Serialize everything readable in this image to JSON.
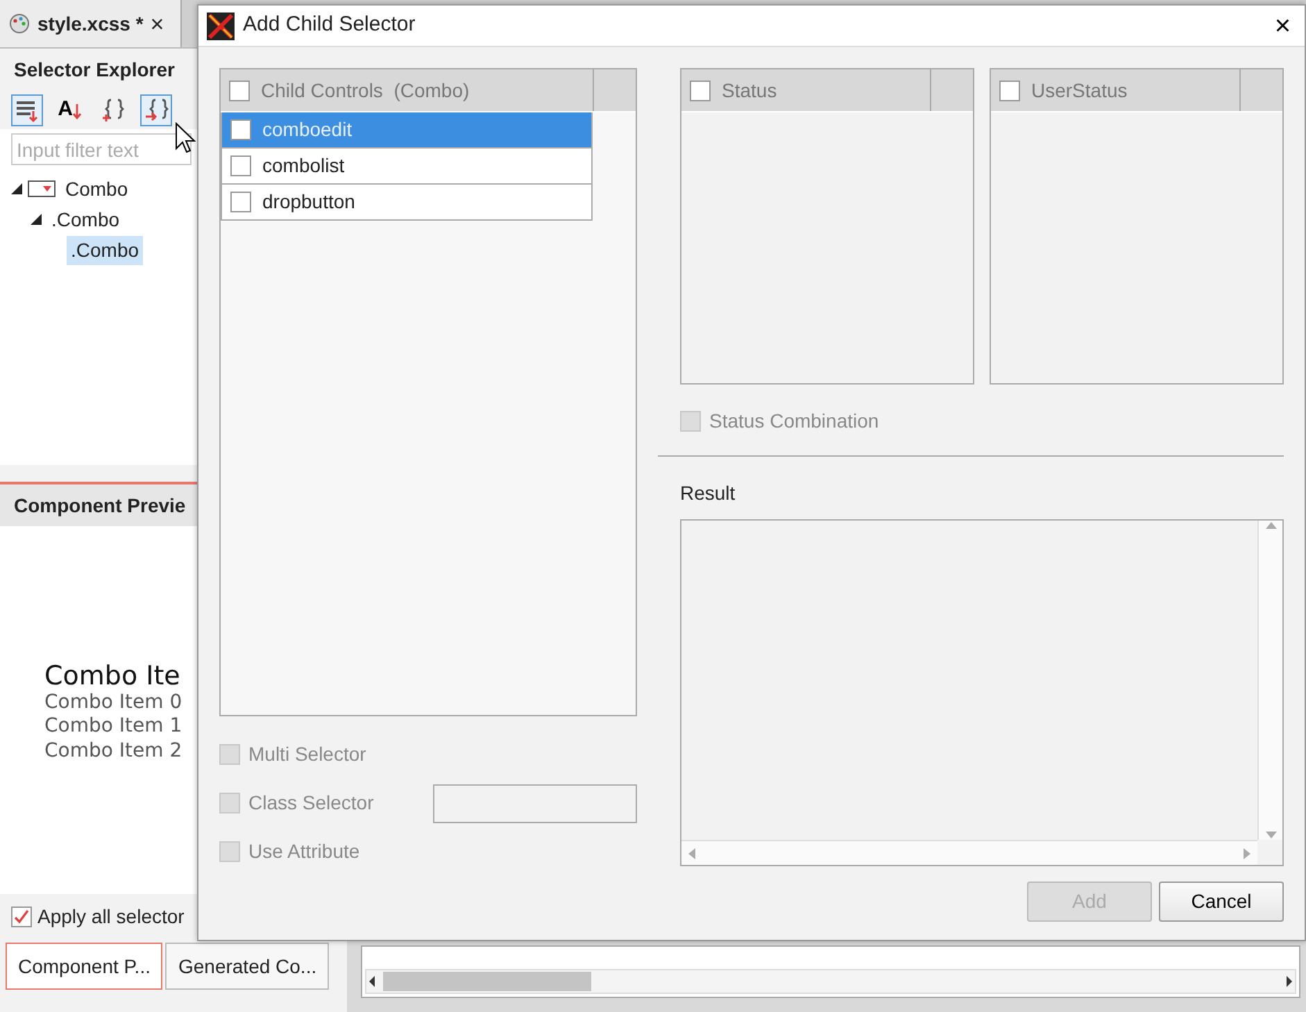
{
  "editor_tab": {
    "title": "style.xcss *",
    "close": "×"
  },
  "selector_explorer": {
    "title": "Selector Explorer",
    "toolbar": [
      {
        "kind": "layers",
        "pressed": true
      },
      {
        "kind": "sort",
        "label": "A",
        "pressed": false
      },
      {
        "kind": "braces-add",
        "pressed": false
      },
      {
        "kind": "braces-arrow",
        "pressed": true
      }
    ],
    "filter": {
      "placeholder": "Input filter text"
    },
    "tree": [
      {
        "label": "Combo",
        "kind": "combo",
        "expanded": true,
        "selected": false,
        "children": [
          {
            "label": ".Combo",
            "expanded": true,
            "selected": false,
            "children": [
              {
                "label": ".Combo",
                "selected": true
              }
            ]
          }
        ]
      }
    ]
  },
  "component_preview": {
    "title": "Component Previe",
    "combo_text": "Combo Ite",
    "items": [
      "Combo Item 0",
      "Combo Item 1",
      "Combo Item 2"
    ],
    "apply_all": {
      "label": "Apply all selector",
      "checked": true
    }
  },
  "bottom_tabs": [
    {
      "label": "Component P...",
      "selected": true
    },
    {
      "label": "Generated Co...",
      "selected": false
    }
  ],
  "dialog": {
    "title": "Add Child Selector",
    "close": "×",
    "child_controls": {
      "header": "Child Controls  (Combo)",
      "checked": false,
      "items": [
        {
          "label": "comboedit",
          "checked": false,
          "selected": true
        },
        {
          "label": "combolist",
          "checked": false,
          "selected": false
        },
        {
          "label": "dropbutton",
          "checked": false,
          "selected": false
        }
      ]
    },
    "options": [
      {
        "label": "Multi Selector",
        "kind": "checkbox",
        "checked": false,
        "disabled": true
      },
      {
        "label": "Class Selector",
        "kind": "checkbox-field",
        "checked": false,
        "disabled": true
      },
      {
        "label": "Use Attribute",
        "kind": "checkbox",
        "checked": false,
        "disabled": true
      }
    ],
    "status_lists": [
      {
        "header": "Status",
        "checked": false
      },
      {
        "header": "UserStatus",
        "checked": false
      }
    ],
    "status_combination": {
      "label": "Status Combination",
      "checked": false,
      "disabled": true
    },
    "result_label": "Result",
    "buttons": [
      {
        "label": "Add",
        "disabled": true
      },
      {
        "label": "Cancel",
        "disabled": false
      }
    ]
  }
}
